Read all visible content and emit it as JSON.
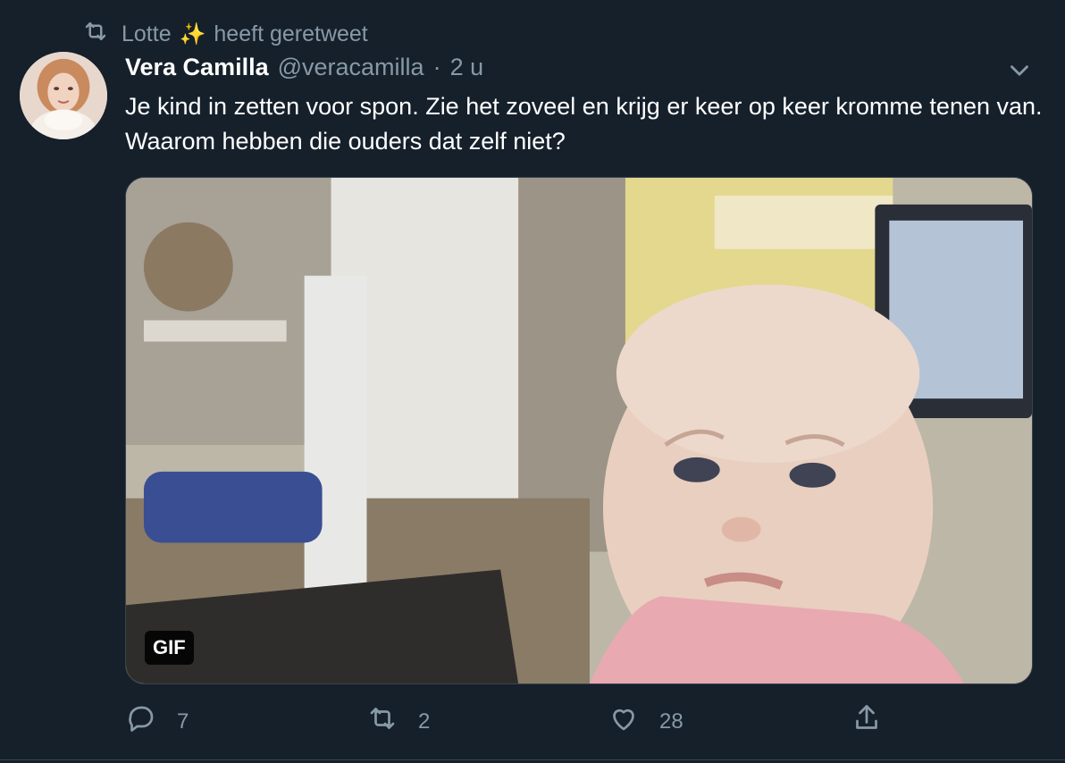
{
  "retweet_context": {
    "label_before": "Lotte",
    "emoji": "✨",
    "label_after": "heeft geretweet"
  },
  "tweet": {
    "author_name": "Vera Camilla",
    "handle": "@veracamilla",
    "separator": "·",
    "time": "2 u",
    "text": "Je kind in zetten voor spon. Zie het zoveel en krijg er keer op keer kromme tenen van. Waarom hebben die ouders dat zelf niet?"
  },
  "media": {
    "badge": "GIF"
  },
  "actions": {
    "reply_count": "7",
    "retweet_count": "2",
    "like_count": "28"
  },
  "colors": {
    "background": "#15202b",
    "secondary_text": "#8899a6",
    "border": "#38444d"
  },
  "icons": [
    "retweet-icon",
    "chevron-down-icon",
    "reply-icon",
    "retweet-icon",
    "like-icon",
    "share-icon"
  ]
}
